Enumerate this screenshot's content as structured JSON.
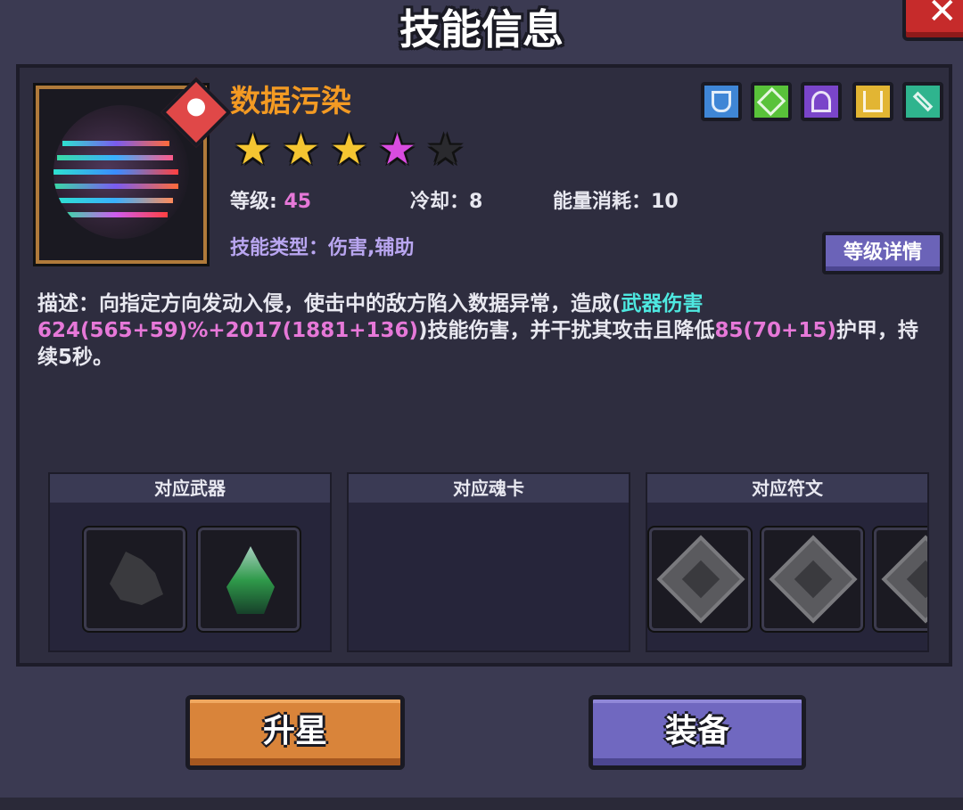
{
  "title": "技能信息",
  "close_label": "✕",
  "skill": {
    "name": "数据污染",
    "stars_total": 5,
    "stars_filled": 4,
    "level_label": "等级:",
    "level_value": "45",
    "cooldown_label": "冷却：",
    "cooldown_value": "8",
    "energy_label": "能量消耗：",
    "energy_value": "10",
    "type_label": "技能类型：",
    "type_value": "伤害,辅助",
    "level_detail_button": "等级详情",
    "tags": [
      {
        "icon": "shield-icon",
        "color": "#3f86d6"
      },
      {
        "icon": "sword-icon",
        "color": "#59c23a"
      },
      {
        "icon": "wizard-hat-icon",
        "color": "#7a45c9"
      },
      {
        "icon": "trident-icon",
        "color": "#e2b533"
      },
      {
        "icon": "blade-icon",
        "color": "#2fb48e"
      }
    ]
  },
  "description": {
    "p1": "描述：向指定方向发动入侵，使击中的敌方陷入数据异常，造成(",
    "weapon_dmg_label": "武器伤害",
    "weapon_dmg_value": "624(565+59)",
    "p2": "%+",
    "flat_dmg": "2017(1881+136)",
    "p3": ")技能伤害，并干扰其攻击且降低",
    "armor_reduction": "85(70+15)",
    "p4": "护甲，持续5秒。"
  },
  "sections": {
    "weapons_title": "对应武器",
    "soulcards_title": "对应魂卡",
    "runes_title": "对应符文"
  },
  "buttons": {
    "star_up": "升星",
    "equip": "装备"
  },
  "colors": {
    "accent_orange": "#f39a23",
    "accent_pink": "#e678d8",
    "accent_cyan": "#4ee8e0"
  }
}
